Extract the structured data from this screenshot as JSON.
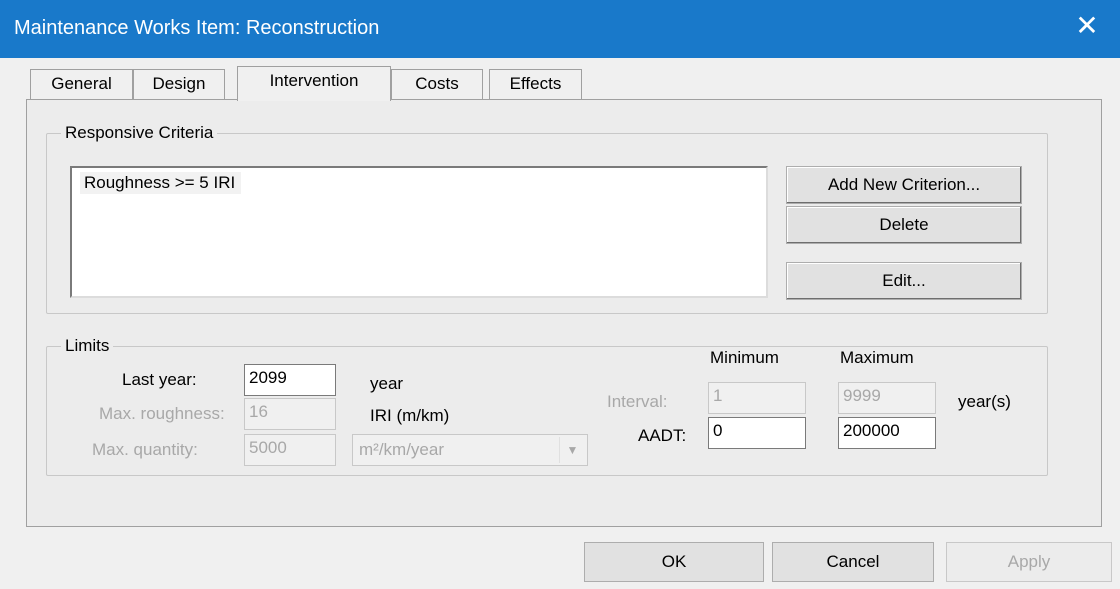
{
  "window": {
    "title": "Maintenance Works Item: Reconstruction",
    "close_symbol": "✕"
  },
  "tabs": [
    {
      "label": "General",
      "active": false
    },
    {
      "label": "Design",
      "active": false
    },
    {
      "label": "Intervention",
      "active": true
    },
    {
      "label": "Costs",
      "active": false
    },
    {
      "label": "Effects",
      "active": false
    }
  ],
  "responsive_criteria": {
    "legend": "Responsive Criteria",
    "items": [
      "Roughness >= 5 IRI"
    ],
    "buttons": {
      "add": "Add New Criterion...",
      "delete": "Delete",
      "edit": "Edit..."
    }
  },
  "limits": {
    "legend": "Limits",
    "last_year": {
      "label": "Last year:",
      "value": "2099",
      "unit": "year"
    },
    "max_roughness": {
      "label": "Max. roughness:",
      "value": "16",
      "unit": "IRI (m/km)"
    },
    "max_quantity": {
      "label": "Max. quantity:",
      "value": "5000",
      "unit": "m²/km/year"
    },
    "col_min": "Minimum",
    "col_max": "Maximum",
    "interval": {
      "label": "Interval:",
      "min": "1",
      "max": "9999",
      "unit": "year(s)"
    },
    "aadt": {
      "label": "AADT:",
      "min": "0",
      "max": "200000"
    }
  },
  "footer": {
    "ok": "OK",
    "cancel": "Cancel",
    "apply": "Apply"
  }
}
